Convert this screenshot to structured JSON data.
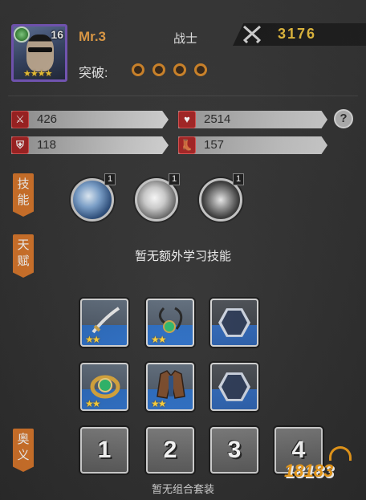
{
  "hero": {
    "level": "16",
    "stars": "★★★★",
    "name": "Mr.3",
    "class": "战士",
    "power": "3176",
    "breakthrough_label": "突破:",
    "breakthrough_total": 4,
    "breakthrough_filled": 0
  },
  "stats": [
    {
      "icon": "sword-icon",
      "value": "426"
    },
    {
      "icon": "heart-icon",
      "value": "2514"
    },
    {
      "icon": "shield-icon",
      "value": "118"
    },
    {
      "icon": "boot-icon",
      "value": "157"
    }
  ],
  "help_label": "?",
  "sections": {
    "skills": "技能",
    "talent": "天赋",
    "ougi": "奥义"
  },
  "skills": [
    {
      "icon": "lightning-skill-icon",
      "level": "1"
    },
    {
      "icon": "wax-skill-icon",
      "level": "1"
    },
    {
      "icon": "candle-skill-icon",
      "level": "1"
    }
  ],
  "talent_text": "暂无额外学习技能",
  "equipment": [
    {
      "icon": "saber-icon",
      "stars": "★★",
      "filled": true
    },
    {
      "icon": "pendant-icon",
      "stars": "★★",
      "filled": true
    },
    {
      "icon": "empty-slot-icon",
      "stars": "",
      "filled": false
    },
    {
      "icon": "ring-icon",
      "stars": "★★",
      "filled": true
    },
    {
      "icon": "coat-icon",
      "stars": "★★",
      "filled": true
    },
    {
      "icon": "empty-slot-icon",
      "stars": "",
      "filled": false
    }
  ],
  "ougi_slots": [
    "1",
    "2",
    "3",
    "4"
  ],
  "combo_text": "暂无组合套装",
  "watermark": "18183",
  "colors": {
    "accent_orange": "#d8762a",
    "name_orange": "#f0a64a",
    "power_gold": "#f4c842",
    "stat_red": "#a82323",
    "slot_blue": "#2d6fc6"
  }
}
